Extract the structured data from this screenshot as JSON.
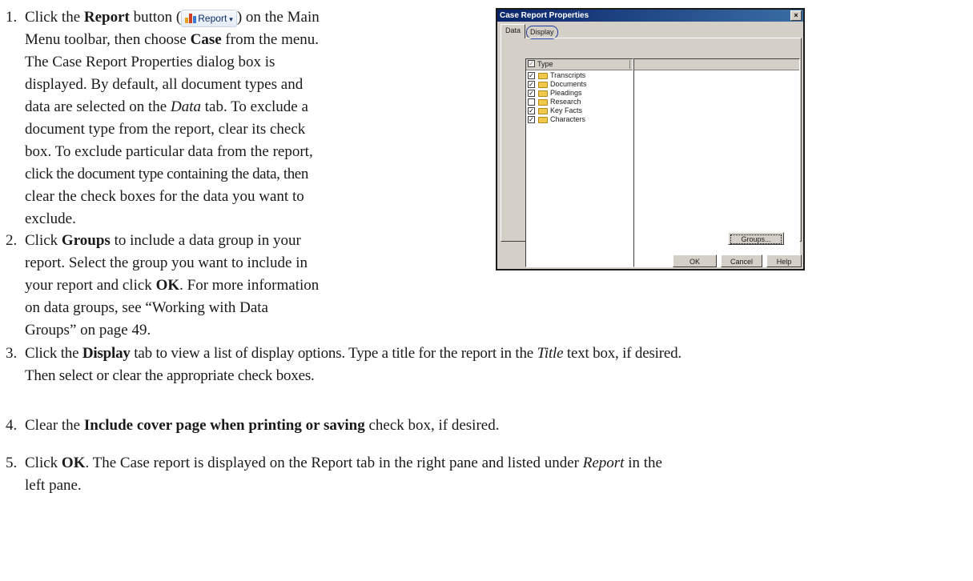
{
  "steps": [
    {
      "num": "1.",
      "lines": [
        "",
        "Menu toolbar, then choose Case from the menu.",
        "The Case Report Properties dialog box is",
        "displayed. By default, all document types and",
        "data are selected on the Data tab. To exclude a",
        "document type from the report, clear its check",
        "box. To exclude particular data from the report,",
        "click the document type containing the data, then",
        "clear the check boxes for the data you want to",
        "exclude."
      ]
    },
    {
      "num": "2."
    },
    {
      "num": "3."
    },
    {
      "num": "4."
    },
    {
      "num": "5."
    }
  ],
  "step1": {
    "a": "Click the ",
    "b": "Report",
    "c": " button (",
    "d": ") on the Main",
    "l2a": "Menu toolbar, then choose ",
    "l2b": "Case",
    "l2c": " from the menu.",
    "l3": "The Case Report Properties dialog box is",
    "l4": "displayed. By default, all document types and",
    "l5a": "data are selected on the ",
    "l5b": "Data",
    "l5c": " tab. To exclude a",
    "l6": "document type from the report, clear its check",
    "l7": "box. To exclude particular data from the report,",
    "l8": "click the document type containing the data, then",
    "l9": "clear the check boxes for the data you want to",
    "l10": "exclude."
  },
  "step2": {
    "l1a": " Click ",
    "l1b": "Groups",
    "l1c": " to include a data group in your",
    "l2": "report. Select the group you want to include in",
    "l3a": "your report and click ",
    "l3b": "OK",
    "l3c": ". For more information",
    "l4": "on data groups, see “Working with Data",
    "l5": "Groups” on page 49."
  },
  "step3": {
    "a": "Click the ",
    "b": "Display",
    "c": " tab to view a list of display options. Type a title for the report in the ",
    "d": "Title",
    "e": " text box, if desired.",
    "l2": "Then select or clear the appropriate check boxes."
  },
  "step4": {
    "a": "Clear the ",
    "b": "Include cover page when printing or saving",
    "c": " check box, if desired."
  },
  "step5": {
    "a": "Click ",
    "b": "OK",
    "c": ". The Case report is displayed on the Report tab in the right pane and listed under ",
    "d": "Report",
    "e": " in the",
    "l2": "left pane."
  },
  "report_button": {
    "label": "Report",
    "caret": "▾",
    "icon": "bar-chart-icon"
  },
  "dialog": {
    "title": "Case Report Properties",
    "close": "×",
    "tabs": [
      {
        "label": "Data"
      },
      {
        "label": "Display"
      }
    ],
    "column_header": "Type",
    "items": [
      {
        "label": "Transcripts",
        "checked": true
      },
      {
        "label": "Documents",
        "checked": true
      },
      {
        "label": "Pleadings",
        "checked": true
      },
      {
        "label": "Research",
        "checked": false
      },
      {
        "label": "Key Facts",
        "checked": true
      },
      {
        "label": "Characters",
        "checked": true
      }
    ],
    "buttons": {
      "groups": "Groups...",
      "ok": "OK",
      "cancel": "Cancel",
      "help": "Help"
    },
    "colors": {
      "titlebar_start": "#0a246a",
      "titlebar_end": "#3a6ea5",
      "face": "#d4d0c8",
      "highlight_circle": "#1f3a9e"
    }
  }
}
